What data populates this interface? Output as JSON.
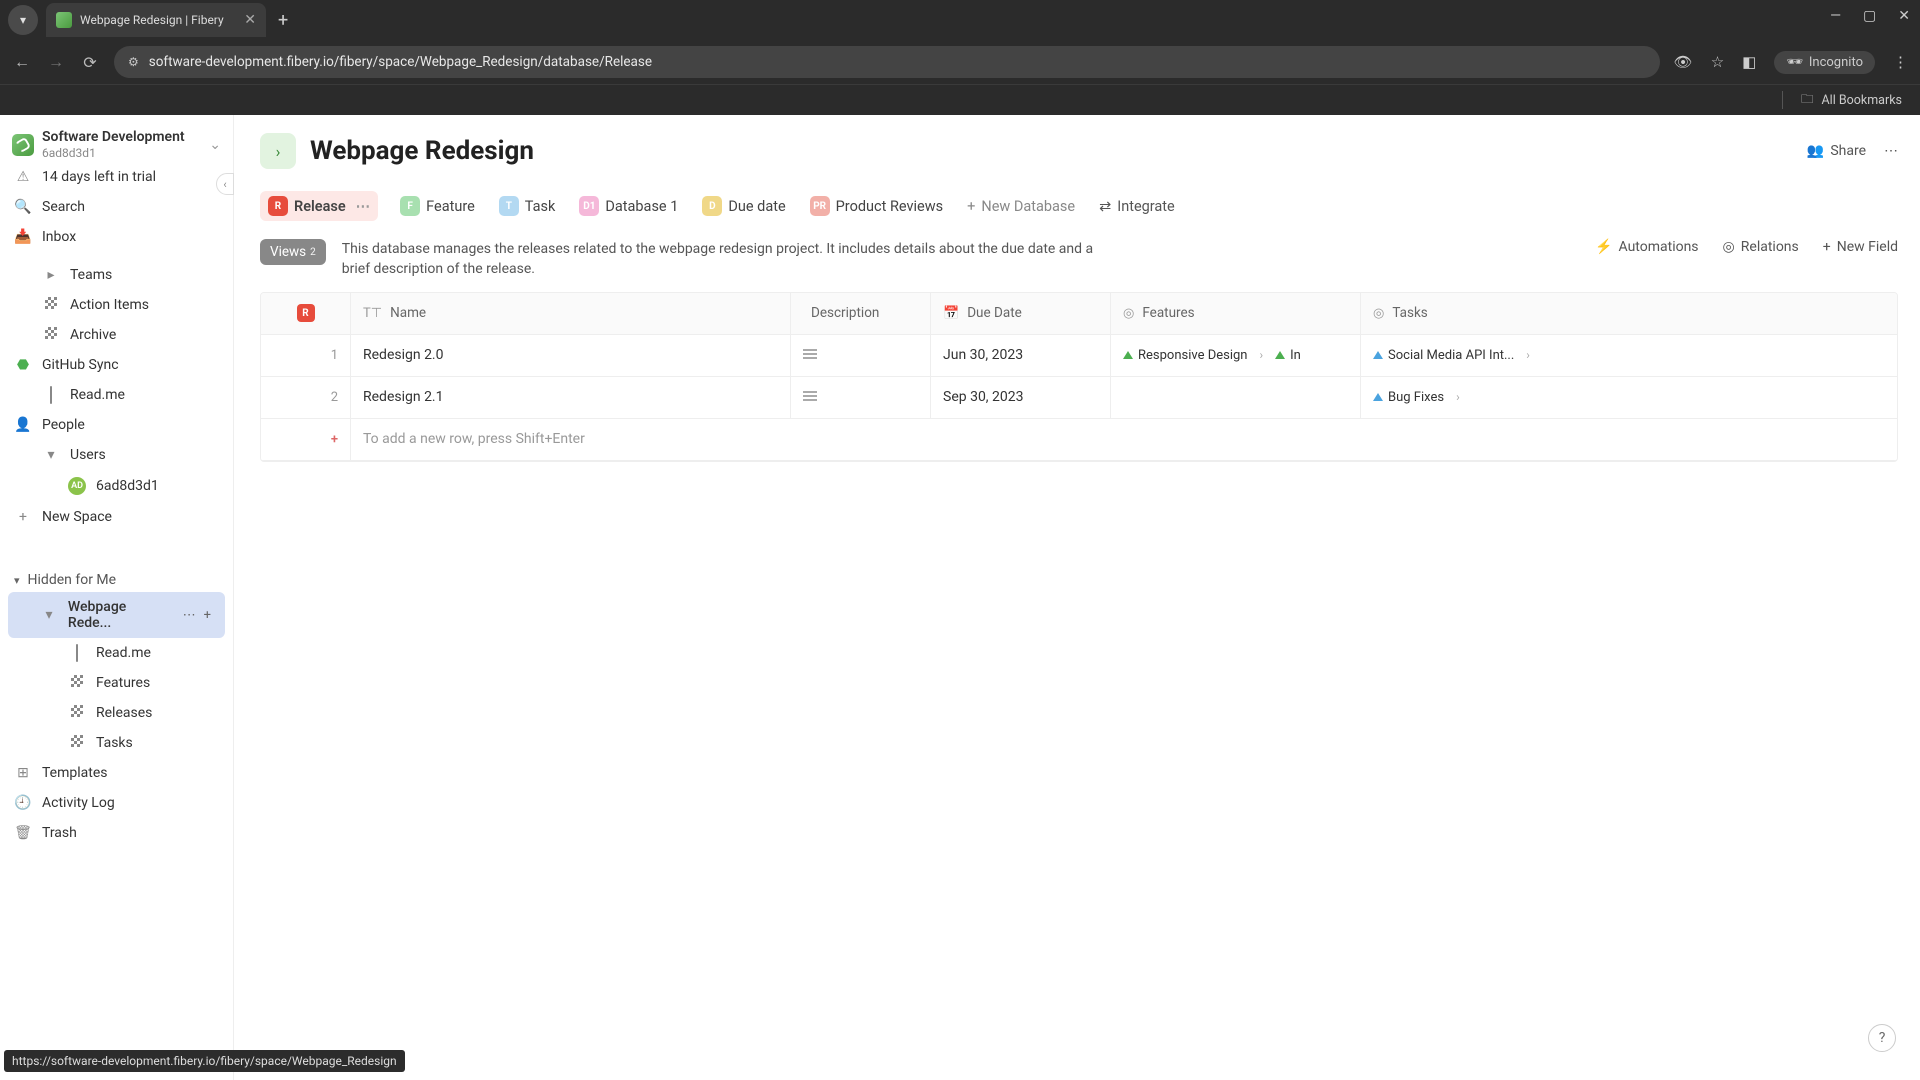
{
  "browser": {
    "tab_title": "Webpage Redesign | Fibery",
    "url": "software-development.fibery.io/fibery/space/Webpage_Redesign/database/Release",
    "incognito_label": "Incognito",
    "all_bookmarks": "All Bookmarks"
  },
  "workspace": {
    "name": "Software Development",
    "subid": "6ad8d3d1"
  },
  "sidebar": {
    "trial": "14 days left in trial",
    "search": "Search",
    "inbox": "Inbox",
    "teams": "Teams",
    "action_items": "Action Items",
    "archive": "Archive",
    "github_sync": "GitHub Sync",
    "readme": "Read.me",
    "people": "People",
    "users": "Users",
    "user_id": "6ad8d3d1",
    "new_space": "New Space",
    "hidden": "Hidden for Me",
    "webpage_redesign": "Webpage Rede...",
    "wr_readme": "Read.me",
    "wr_features": "Features",
    "wr_releases": "Releases",
    "wr_tasks": "Tasks",
    "templates": "Templates",
    "activity_log": "Activity Log",
    "trash": "Trash"
  },
  "page": {
    "title": "Webpage Redesign",
    "share": "Share"
  },
  "db_tabs": {
    "release": "Release",
    "feature": "Feature",
    "task": "Task",
    "database1": "Database 1",
    "due_date": "Due date",
    "product_reviews": "Product Reviews",
    "new_database": "New Database",
    "integrate": "Integrate"
  },
  "subbar": {
    "views": "Views",
    "views_count": "2",
    "description": "This database manages the releases related to the webpage redesign project. It includes details about the due date and a brief description of the release.",
    "automations": "Automations",
    "relations": "Relations",
    "new_field": "New Field"
  },
  "columns": {
    "name": "Name",
    "description": "Description",
    "due_date": "Due Date",
    "features": "Features",
    "tasks": "Tasks"
  },
  "rows": [
    {
      "num": "1",
      "name": "Redesign 2.0",
      "due": "Jun 30, 2023",
      "features": [
        "Responsive Design",
        "In"
      ],
      "tasks": [
        "Social Media API Int..."
      ]
    },
    {
      "num": "2",
      "name": "Redesign 2.1",
      "due": "Sep 30, 2023",
      "features": [],
      "tasks": [
        "Bug Fixes"
      ]
    }
  ],
  "addrow": "To add a new row, press Shift+Enter",
  "status_url": "https://software-development.fibery.io/fibery/space/Webpage_Redesign"
}
